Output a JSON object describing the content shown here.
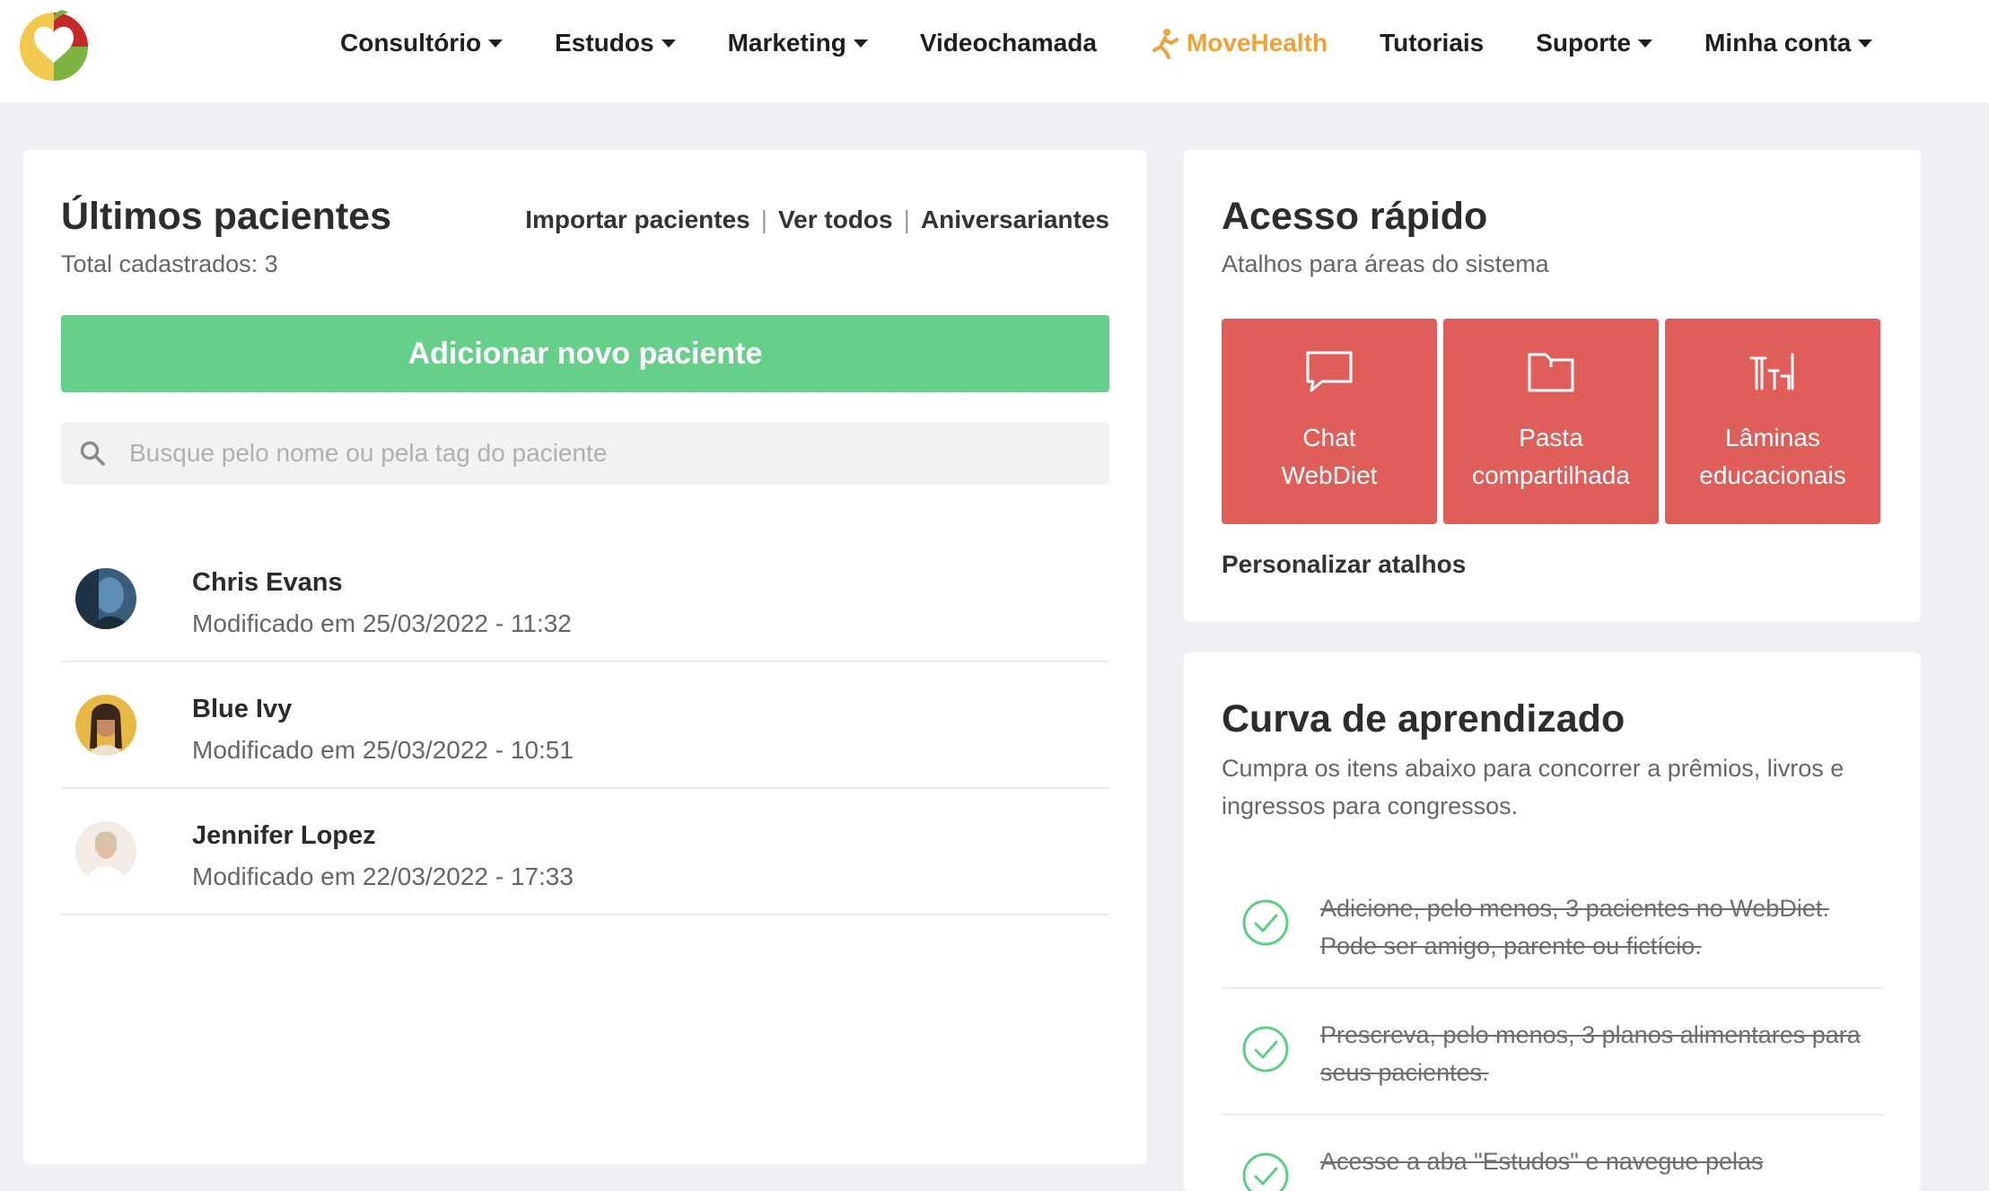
{
  "nav": {
    "items": [
      {
        "label": "Consultório",
        "dropdown": true
      },
      {
        "label": "Estudos",
        "dropdown": true
      },
      {
        "label": "Marketing",
        "dropdown": true
      },
      {
        "label": "Videochamada",
        "dropdown": false
      },
      {
        "label": "MoveHealth",
        "dropdown": false,
        "accent": "#f0a23a",
        "icon": "running-person-icon"
      },
      {
        "label": "Tutoriais",
        "dropdown": false
      },
      {
        "label": "Suporte",
        "dropdown": true
      },
      {
        "label": "Minha conta",
        "dropdown": true
      }
    ]
  },
  "patients": {
    "title": "Últimos pacientes",
    "total": "Total cadastrados: 3",
    "links": {
      "import": "Importar pacientes",
      "all": "Ver todos",
      "birthdays": "Aniversariantes"
    },
    "separator": "|",
    "add_button": "Adicionar novo paciente",
    "search_placeholder": "Busque pelo nome ou pela tag do paciente",
    "list": [
      {
        "name": "Chris Evans",
        "modified": "Modificado em 25/03/2022 - 11:32"
      },
      {
        "name": "Blue Ivy",
        "modified": "Modificado em 25/03/2022 - 10:51"
      },
      {
        "name": "Jennifer Lopez",
        "modified": "Modificado em 22/03/2022 - 17:33"
      }
    ]
  },
  "quick_access": {
    "title": "Acesso rápido",
    "subtitle": "Atalhos para áreas do sistema",
    "tiles": [
      {
        "line1": "Chat",
        "line2": "WebDiet",
        "icon": "chat-bubble-icon"
      },
      {
        "line1": "Pasta",
        "line2": "compartilhada",
        "icon": "folder-icon"
      },
      {
        "line1": "Lâminas",
        "line2": "educacionais",
        "icon": "slides-icon"
      }
    ],
    "customize": "Personalizar atalhos",
    "tile_color": "#e05e59"
  },
  "learning_curve": {
    "title": "Curva de aprendizado",
    "subtitle": "Cumpra os itens abaixo para concorrer a prêmios, livros e ingressos para congressos.",
    "tasks": [
      {
        "text": "Adicione, pelo menos, 3 pacientes no WebDiet. Pode ser amigo, parente ou fictício.",
        "done": true
      },
      {
        "text": "Prescreva, pelo menos, 3 planos alimentares para seus pacientes.",
        "done": true
      },
      {
        "text": "Acesse a aba \"Estudos\" e navegue pelas",
        "done": true
      }
    ]
  },
  "colors": {
    "primary_green": "#66cf8a",
    "check_green": "#5ccf86",
    "background": "#eef0f3"
  }
}
